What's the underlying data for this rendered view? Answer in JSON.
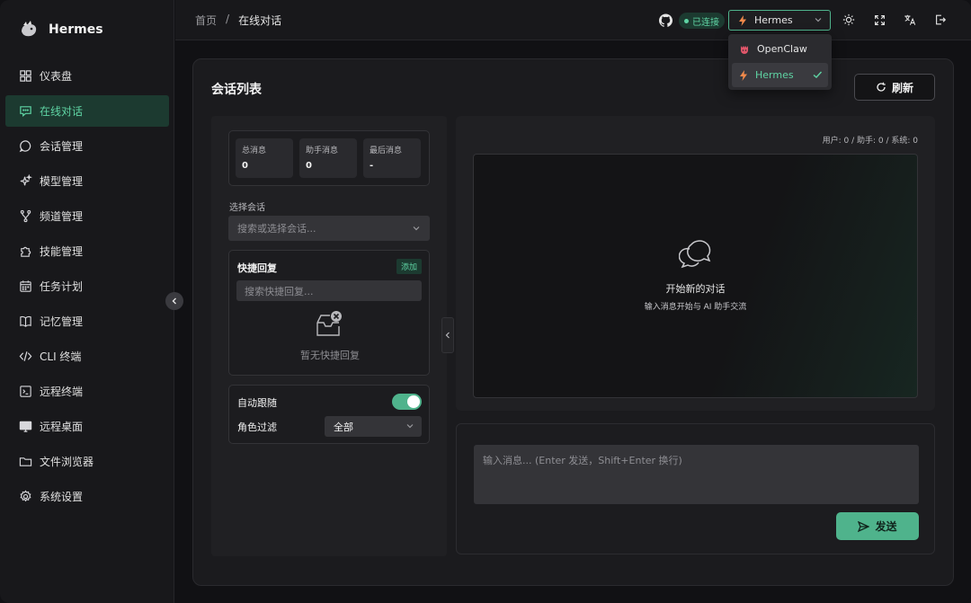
{
  "brand": {
    "name": "Hermes"
  },
  "sidebar": {
    "items": [
      {
        "label": "仪表盘",
        "icon": "dashboard-icon"
      },
      {
        "label": "在线对话",
        "icon": "chat-icon",
        "active": true
      },
      {
        "label": "会话管理",
        "icon": "session-icon"
      },
      {
        "label": "模型管理",
        "icon": "sparkles-icon"
      },
      {
        "label": "频道管理",
        "icon": "branch-icon"
      },
      {
        "label": "技能管理",
        "icon": "puzzle-icon"
      },
      {
        "label": "任务计划",
        "icon": "calendar-icon"
      },
      {
        "label": "记忆管理",
        "icon": "book-icon"
      },
      {
        "label": "CLI 终端",
        "icon": "code-icon"
      },
      {
        "label": "远程终端",
        "icon": "terminal-icon"
      },
      {
        "label": "远程桌面",
        "icon": "monitor-icon"
      },
      {
        "label": "文件浏览器",
        "icon": "folder-icon"
      },
      {
        "label": "系统设置",
        "icon": "gear-icon"
      }
    ]
  },
  "header": {
    "breadcrumb": {
      "home": "首页",
      "sep": "/",
      "current": "在线对话"
    },
    "status": "已连接",
    "agent_selected": "Hermes",
    "agent_options": [
      "OpenClaw",
      "Hermes"
    ]
  },
  "panel": {
    "title": "会话列表",
    "refresh_label": "刷新",
    "stats": [
      {
        "label": "总消息",
        "value": "0"
      },
      {
        "label": "助手消息",
        "value": "0"
      },
      {
        "label": "最后消息",
        "value": "-"
      }
    ],
    "select_label": "选择会话",
    "select_placeholder": "搜索或选择会话...",
    "quick_reply": {
      "title": "快捷回复",
      "add_label": "添加",
      "search_placeholder": "搜索快捷回复...",
      "empty_text": "暂无快捷回复"
    },
    "auto_follow_label": "自动跟随",
    "auto_follow_on": true,
    "role_filter_label": "角色过滤",
    "role_filter_value": "全部"
  },
  "chat": {
    "counts": "用户: 0 / 助手: 0 / 系统: 0",
    "empty_title": "开始新的对话",
    "empty_sub": "输入消息开始与 AI 助手交流",
    "input_placeholder": "输入消息... (Enter 发送，Shift+Enter 换行)",
    "send_label": "发送"
  },
  "colors": {
    "accent": "#4fb38c",
    "accent_text": "#5fd4a4",
    "active_bg": "#1c3a30",
    "background": "#111114",
    "sidebar": "#18181b"
  }
}
